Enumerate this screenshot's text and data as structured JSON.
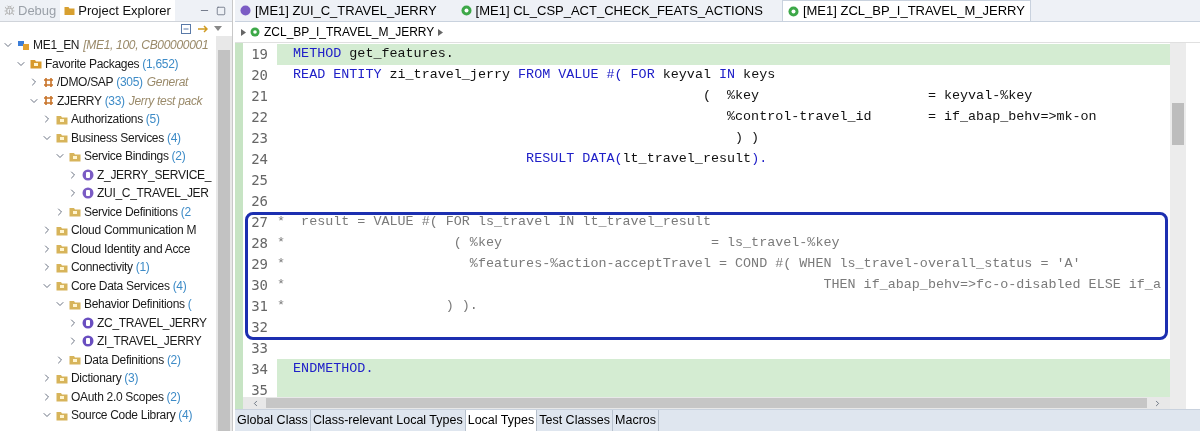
{
  "left_view": {
    "tabs": [
      {
        "label": "Debug",
        "selected": false
      },
      {
        "label": "Project Explorer",
        "selected": true
      }
    ],
    "tree": [
      {
        "kind": "system",
        "label": "ME1_EN",
        "description": "[ME1, 100, CB00000001",
        "expanded": true,
        "children": [
          {
            "kind": "favorites",
            "label": "Favorite Packages",
            "count": "(1,652)",
            "expanded": true,
            "children": [
              {
                "kind": "package",
                "label": "/DMO/SAP",
                "count": "(305)",
                "description": "Generat",
                "expanded": false
              },
              {
                "kind": "package",
                "label": "ZJERRY",
                "count": "(33)",
                "description": "Jerry test pack",
                "expanded": true,
                "children": [
                  {
                    "kind": "folder",
                    "label": "Authorizations",
                    "count": "(5)",
                    "expanded": false
                  },
                  {
                    "kind": "folder",
                    "label": "Business Services",
                    "count": "(4)",
                    "expanded": true,
                    "children": [
                      {
                        "kind": "folder",
                        "label": "Service Bindings",
                        "count": "(2)",
                        "expanded": true,
                        "children": [
                          {
                            "kind": "binding",
                            "label": "Z_JERRY_SERVICE_",
                            "expanded": false
                          },
                          {
                            "kind": "binding",
                            "label": "ZUI_C_TRAVEL_JER",
                            "expanded": false
                          }
                        ]
                      },
                      {
                        "kind": "folder",
                        "label": "Service Definitions",
                        "count": "(2",
                        "expanded": false
                      }
                    ]
                  },
                  {
                    "kind": "folder",
                    "label": "Cloud Communication M",
                    "expanded": false
                  },
                  {
                    "kind": "folder",
                    "label": "Cloud Identity and Acce",
                    "expanded": false
                  },
                  {
                    "kind": "folder",
                    "label": "Connectivity",
                    "count": "(1)",
                    "expanded": false
                  },
                  {
                    "kind": "folder",
                    "label": "Core Data Services",
                    "count": "(4)",
                    "expanded": true,
                    "children": [
                      {
                        "kind": "folder",
                        "label": "Behavior Definitions",
                        "count": "(",
                        "expanded": true,
                        "children": [
                          {
                            "kind": "behavior",
                            "label": "ZC_TRAVEL_JERRY",
                            "expanded": false
                          },
                          {
                            "kind": "behavior",
                            "label": "ZI_TRAVEL_JERRY",
                            "expanded": false
                          }
                        ]
                      },
                      {
                        "kind": "folder",
                        "label": "Data Definitions",
                        "count": "(2)",
                        "expanded": false
                      }
                    ]
                  },
                  {
                    "kind": "folder",
                    "label": "Dictionary",
                    "count": "(3)",
                    "expanded": false
                  },
                  {
                    "kind": "folder",
                    "label": "OAuth 2.0 Scopes",
                    "count": "(2)",
                    "expanded": false
                  },
                  {
                    "kind": "folder",
                    "label": "Source Code Library",
                    "count": "(4)",
                    "expanded": true
                  }
                ]
              }
            ]
          }
        ]
      }
    ]
  },
  "editor": {
    "tabs": [
      {
        "label": "[ME1] ZUI_C_TRAVEL_JERRY",
        "kind": "binding",
        "selected": false
      },
      {
        "label": "[ME1] CL_CSP_ACT_CHECK_FEATS_ACTIONS",
        "kind": "class",
        "selected": false
      },
      {
        "label": "[ME1] ZCL_BP_I_TRAVEL_M_JERRY",
        "kind": "class",
        "selected": true
      }
    ],
    "breadcrumb": "ZCL_BP_I_TRAVEL_M_JERRY",
    "lines": [
      {
        "number": "19",
        "highlighted": true,
        "tokens": [
          {
            "kind": "keyword",
            "text": "  METHOD "
          },
          {
            "kind": "text",
            "text": "get_features."
          }
        ]
      },
      {
        "number": "20",
        "highlighted": false,
        "tokens": [
          {
            "kind": "keyword",
            "text": "  READ ENTITY "
          },
          {
            "kind": "text",
            "text": "zi_travel_jerry "
          },
          {
            "kind": "keyword",
            "text": "FROM VALUE #( FOR "
          },
          {
            "kind": "text",
            "text": "keyval "
          },
          {
            "kind": "keyword",
            "text": "IN "
          },
          {
            "kind": "text",
            "text": "keys"
          }
        ]
      },
      {
        "number": "21",
        "highlighted": false,
        "tokens": [
          {
            "kind": "text",
            "text": "                                                     (  %key                     = keyval-%key"
          }
        ]
      },
      {
        "number": "22",
        "highlighted": false,
        "tokens": [
          {
            "kind": "text",
            "text": "                                                        %control-travel_id       = if_abap_behv=>mk-on"
          }
        ]
      },
      {
        "number": "23",
        "highlighted": false,
        "tokens": [
          {
            "kind": "text",
            "text": "                                                         ) )"
          }
        ]
      },
      {
        "number": "24",
        "highlighted": false,
        "tokens": [
          {
            "kind": "keyword",
            "text": "                               RESULT DATA("
          },
          {
            "kind": "text",
            "text": "lt_travel_result"
          },
          {
            "kind": "keyword",
            "text": ")."
          }
        ]
      },
      {
        "number": "25",
        "highlighted": false
      },
      {
        "number": "26",
        "highlighted": false
      },
      {
        "number": "27",
        "highlighted": false,
        "tokens": [
          {
            "kind": "comment",
            "text": "*  result = VALUE #( FOR ls_travel IN lt_travel_result"
          }
        ]
      },
      {
        "number": "28",
        "highlighted": false,
        "tokens": [
          {
            "kind": "comment",
            "text": "*                     ( %key                          = ls_travel-%key"
          }
        ]
      },
      {
        "number": "29",
        "highlighted": false,
        "tokens": [
          {
            "kind": "comment",
            "text": "*                       %features-%action-acceptTravel = COND #( WHEN ls_travel-overall_status = 'A'"
          }
        ]
      },
      {
        "number": "30",
        "highlighted": false,
        "tokens": [
          {
            "kind": "comment",
            "text": "*                                                                   THEN if_abap_behv=>fc-o-disabled ELSE if_a"
          }
        ]
      },
      {
        "number": "31",
        "highlighted": false,
        "tokens": [
          {
            "kind": "comment",
            "text": "*                    ) )."
          }
        ]
      },
      {
        "number": "32",
        "highlighted": false
      },
      {
        "number": "33",
        "highlighted": false
      },
      {
        "number": "34",
        "highlighted": true,
        "tokens": [
          {
            "kind": "keyword",
            "text": "  ENDMETHOD."
          }
        ]
      },
      {
        "number": "35",
        "highlighted": true
      }
    ],
    "bottom_tabs": [
      {
        "label": "Global Class",
        "selected": false
      },
      {
        "label": "Class-relevant Local Types",
        "selected": false
      },
      {
        "label": "Local Types",
        "selected": true
      },
      {
        "label": "Test Classes",
        "selected": false
      },
      {
        "label": "Macros",
        "selected": false
      }
    ]
  }
}
